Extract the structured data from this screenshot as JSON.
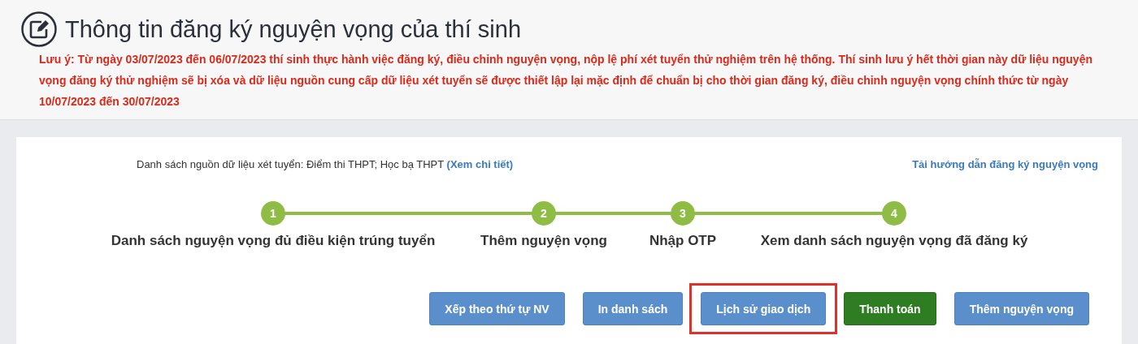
{
  "header": {
    "title": "Thông tin đăng ký nguyện vọng của thí sinh",
    "note": "Lưu ý: Từ ngày 03/07/2023 đến 06/07/2023 thí sinh thực hành việc đăng ký, điều chỉnh nguyện vọng, nộp lệ phí xét tuyển thử nghiệm trên hệ thống. Thí sinh lưu ý hết thời gian này dữ liệu nguyện vọng đăng ký thử nghiệm sẽ bị xóa và dữ liệu nguồn cung cấp dữ liệu xét tuyển sẽ được thiết lập lại mặc định để chuẩn bị cho thời gian đăng ký, điều chỉnh nguyện vọng chính thức từ ngày 10/07/2023 đến 30/07/2023"
  },
  "sources": {
    "text": "Danh sách nguồn dữ liệu xét tuyển: Điểm thi THPT; Học bạ THPT",
    "link": "(Xem chi tiết)"
  },
  "guide_link": "Tải hướng dẫn đăng ký nguyện vọng",
  "steps": [
    {
      "number": "1",
      "label": "Danh sách nguyện vọng đủ điều kiện trúng tuyển"
    },
    {
      "number": "2",
      "label": "Thêm nguyện vọng"
    },
    {
      "number": "3",
      "label": "Nhập OTP"
    },
    {
      "number": "4",
      "label": "Xem danh sách nguyện vọng đã đăng ký"
    }
  ],
  "buttons": [
    {
      "label": "Xếp theo thứ tự NV",
      "kind": "primary",
      "highlighted": false
    },
    {
      "label": "In danh sách",
      "kind": "primary",
      "highlighted": false
    },
    {
      "label": "Lịch sử giao dịch",
      "kind": "primary",
      "highlighted": true
    },
    {
      "label": "Thanh toán",
      "kind": "success",
      "highlighted": false
    },
    {
      "label": "Thêm nguyện vọng",
      "kind": "primary",
      "highlighted": false
    }
  ]
}
